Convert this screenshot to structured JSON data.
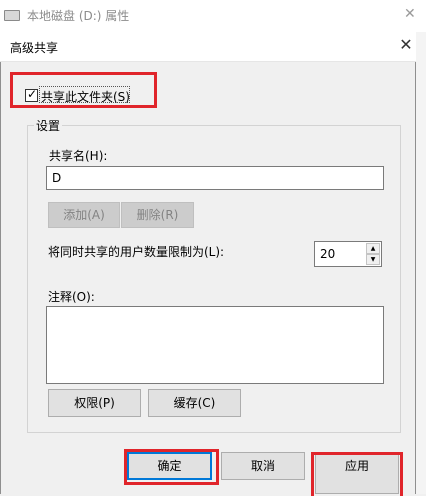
{
  "parent_window": {
    "title": "本地磁盘 (D:) 属性",
    "close_glyph": "✕",
    "icon": "drive-icon"
  },
  "dialog": {
    "title": "高级共享",
    "close_glyph": "✕"
  },
  "share": {
    "checkbox_label": "共享此文件夹(S)",
    "checked": true,
    "check_glyph": "✓"
  },
  "settings": {
    "group_label": "设置",
    "share_name_label": "共享名(H):",
    "share_name_value": "D",
    "add_button": "添加(A)",
    "remove_button": "删除(R)",
    "user_limit_label": "将同时共享的用户数量限制为(L):",
    "user_limit_value": "20",
    "spin_up_glyph": "▲",
    "spin_down_glyph": "▼",
    "comments_label": "注释(O):",
    "comments_value": "",
    "permissions_button": "权限(P)",
    "caching_button": "缓存(C)"
  },
  "footer": {
    "ok_button": "确定",
    "cancel_button": "取消",
    "apply_button": "应用"
  },
  "annotations": {
    "highlight_color": "#e0252b",
    "focus_color": "#0078d7"
  }
}
